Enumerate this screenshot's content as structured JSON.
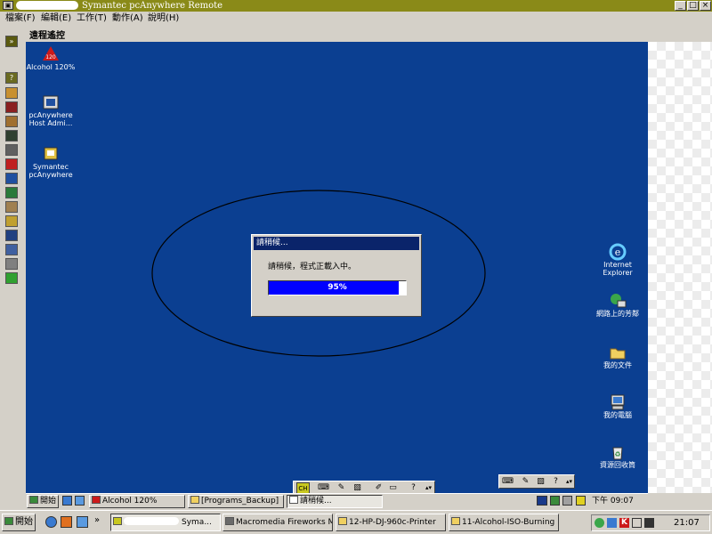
{
  "window": {
    "title": "Symantec pcAnywhere Remote",
    "minimize": "_",
    "maximize": "□",
    "close": "×"
  },
  "menu": [
    "檔案(F)",
    "編輯(E)",
    "工作(T)",
    "動作(A)",
    "說明(H)"
  ],
  "panel": {
    "title": "遠程遙控",
    "expand_glyph": "»"
  },
  "remote_desktop": {
    "icons_left": [
      {
        "label": "Alcohol 120%",
        "icon": "alcohol-icon"
      },
      {
        "label": "pcAnywhere\nHost Admi...",
        "icon": "pcanywhere-host-icon"
      },
      {
        "label": "Symantec\npcAnywhere",
        "icon": "pcanywhere-icon"
      }
    ],
    "icons_right": [
      {
        "label": "Internet\nExplorer",
        "icon": "internet-explorer-icon"
      },
      {
        "label": "網路上的芳鄰",
        "icon": "network-icon"
      },
      {
        "label": "我的文件",
        "icon": "folder-icon"
      },
      {
        "label": "我的電腦",
        "icon": "computer-icon"
      },
      {
        "label": "資源回收筒",
        "icon": "recycle-bin-icon"
      }
    ]
  },
  "dialog": {
    "title": "請稍候...",
    "message": "請稍候，程式正載入中。",
    "progress_text": "95%",
    "progress_value": 0.95
  },
  "remote_taskbar": {
    "start": "開始",
    "buttons": [
      "Alcohol 120%",
      "[Programs_Backup]",
      "請稍候..."
    ],
    "clock": "下午 09:07"
  },
  "taskbar": {
    "start": "開始",
    "chevron": "»",
    "buttons": [
      "Syma...",
      "Macromedia Fireworks M...",
      "12-HP-DJ-960c-Printer",
      "11-Alcohol-ISO-Burning"
    ],
    "clock": "21:07"
  }
}
